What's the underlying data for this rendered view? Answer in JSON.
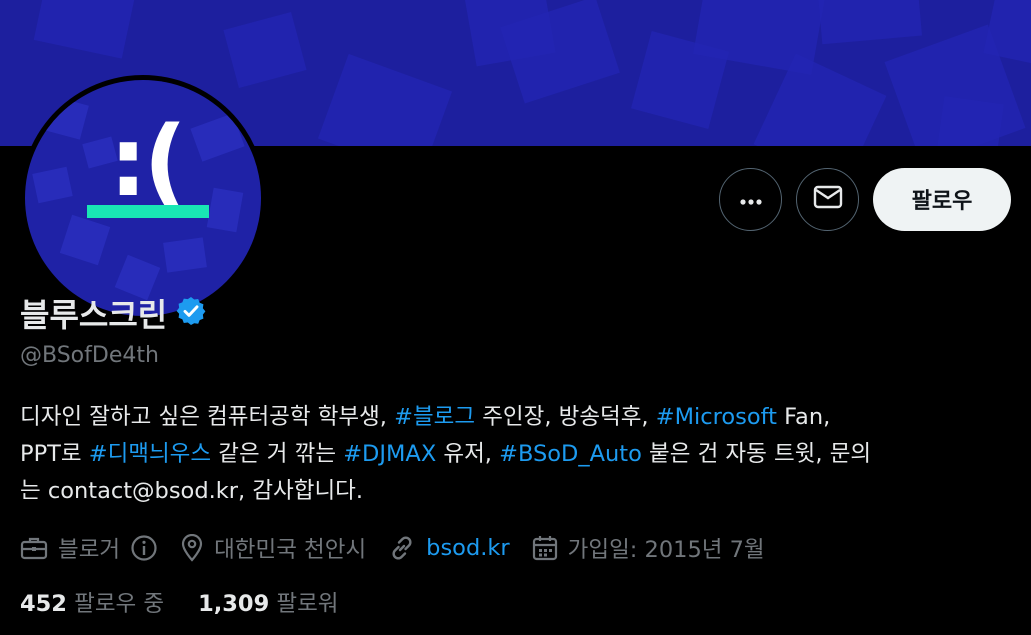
{
  "profile": {
    "name": "블루스크린",
    "handle": "@BSofDe4th",
    "avatar_text": ":(",
    "verified": true
  },
  "actions": {
    "more_icon": "more-horizontal-icon",
    "message_icon": "envelope-icon",
    "follow_label": "팔로우"
  },
  "bio": {
    "p1": "디자인 잘하고 싶은 컴퓨터공학 학부생, ",
    "tag1": "#블로그",
    "p2": " 주인장, 방송덕후, ",
    "tag2": "#Microsoft",
    "p3": " Fan,",
    "p4": "PPT로 ",
    "tag3": "#디맥늬우스",
    "p5": " 같은 거 깎는 ",
    "tag4": "#DJMAX",
    "p6": " 유저, ",
    "tag5": "#BSoD_Auto",
    "p7": " 붙은 건 자동 트윗, 문의",
    "p8": "는 contact@bsod.kr, 감사합니다."
  },
  "meta": {
    "category": "블로거",
    "location": "대한민국 천안시",
    "website": "bsod.kr",
    "joined": "가입일: 2015년 7월"
  },
  "stats": {
    "following_count": "452",
    "following_label": "팔로우 중",
    "followers_count": "1,309",
    "followers_label": "팔로워"
  },
  "colors": {
    "accent": "#1d9bf0",
    "banner": "#1d1f9e",
    "avatar_bar": "#19e6b4",
    "muted": "#71767b"
  }
}
